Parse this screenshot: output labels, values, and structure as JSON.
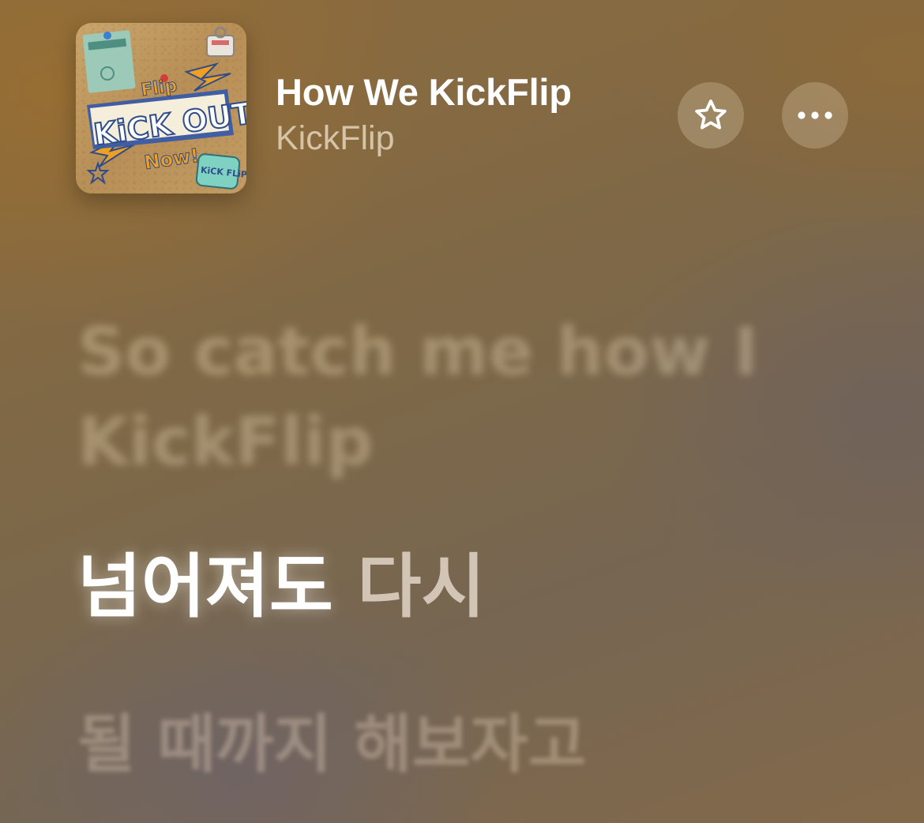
{
  "now_playing": {
    "title": "How We KickFlip",
    "artist": "KickFlip",
    "artwork": {
      "text_flip": "Flip",
      "text_kickout": "KiCK OUT,",
      "text_now": "Now!",
      "badge_text": "KiCK FLiP"
    }
  },
  "controls": {
    "favorite_icon": "star-outline-icon",
    "more_icon": "ellipsis-icon"
  },
  "lyrics": {
    "previous": "So catch me how I KickFlip",
    "current_sung": "넘어져도",
    "current_upcoming": "다시",
    "next": "될 때까지 해보자고"
  },
  "colors": {
    "background_warm": "#8d6b3c",
    "background_cool": "#766652",
    "title": "#ffffff",
    "artist": "#ecdec4",
    "button_bg": "#fff0dc"
  }
}
